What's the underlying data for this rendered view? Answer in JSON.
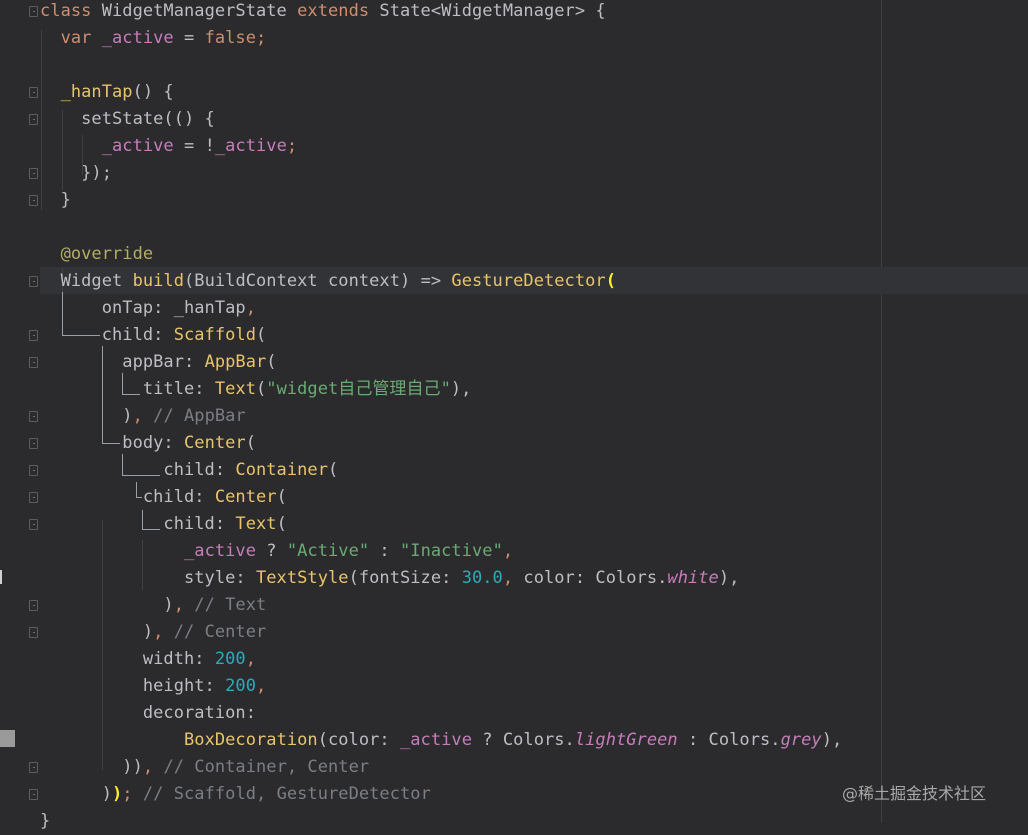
{
  "editor": {
    "lines": [
      [
        {
          "t": "class ",
          "c": "kw"
        },
        {
          "t": "WidgetManagerState ",
          "c": "plain"
        },
        {
          "t": "extends ",
          "c": "kw"
        },
        {
          "t": "State<WidgetManager> {",
          "c": "plain"
        }
      ],
      [
        {
          "t": "  ",
          "c": "plain"
        },
        {
          "t": "var ",
          "c": "kw"
        },
        {
          "t": "_active",
          "c": "prop"
        },
        {
          "t": " = ",
          "c": "plain"
        },
        {
          "t": "false",
          "c": "kw"
        },
        {
          "t": ";",
          "c": "kw"
        }
      ],
      [],
      [
        {
          "t": "  ",
          "c": "plain"
        },
        {
          "t": "_hanTap",
          "c": "cls"
        },
        {
          "t": "() {",
          "c": "plain"
        }
      ],
      [
        {
          "t": "    setState(() {",
          "c": "plain"
        }
      ],
      [
        {
          "t": "      ",
          "c": "plain"
        },
        {
          "t": "_active",
          "c": "prop"
        },
        {
          "t": " = !",
          "c": "plain"
        },
        {
          "t": "_active",
          "c": "prop"
        },
        {
          "t": ";",
          "c": "kw"
        }
      ],
      [
        {
          "t": "    });",
          "c": "plain"
        }
      ],
      [
        {
          "t": "  }",
          "c": "plain"
        }
      ],
      [],
      [
        {
          "t": "  ",
          "c": "plain"
        },
        {
          "t": "@override",
          "c": "ann"
        }
      ],
      [
        {
          "t": "  Widget ",
          "c": "plain"
        },
        {
          "t": "build",
          "c": "cls"
        },
        {
          "t": "(BuildContext context) => ",
          "c": "plain"
        },
        {
          "t": "GestureDetector",
          "c": "cls"
        },
        {
          "t": "(",
          "c": "brace-hl"
        }
      ],
      [
        {
          "t": "      onTap: _hanTap",
          "c": "plain"
        },
        {
          "t": ",",
          "c": "kw"
        }
      ],
      [
        {
          "t": "      child: ",
          "c": "plain"
        },
        {
          "t": "Scaffold",
          "c": "cls"
        },
        {
          "t": "(",
          "c": "plain"
        }
      ],
      [
        {
          "t": "        appBar: ",
          "c": "plain"
        },
        {
          "t": "AppBar",
          "c": "cls"
        },
        {
          "t": "(",
          "c": "plain"
        }
      ],
      [
        {
          "t": "          title: ",
          "c": "plain"
        },
        {
          "t": "Text",
          "c": "cls"
        },
        {
          "t": "(",
          "c": "plain"
        },
        {
          "t": "\"widget自己管理自己\"",
          "c": "str"
        },
        {
          "t": "),",
          "c": "plain"
        }
      ],
      [
        {
          "t": "        )",
          "c": "plain"
        },
        {
          "t": ", ",
          "c": "kw"
        },
        {
          "t": "// AppBar",
          "c": "cmt"
        }
      ],
      [
        {
          "t": "        body: ",
          "c": "plain"
        },
        {
          "t": "Center",
          "c": "cls"
        },
        {
          "t": "(",
          "c": "plain"
        }
      ],
      [
        {
          "t": "            child: ",
          "c": "plain"
        },
        {
          "t": "Container",
          "c": "cls"
        },
        {
          "t": "(",
          "c": "plain"
        }
      ],
      [
        {
          "t": "          child: ",
          "c": "plain"
        },
        {
          "t": "Center",
          "c": "cls"
        },
        {
          "t": "(",
          "c": "plain"
        }
      ],
      [
        {
          "t": "            child: ",
          "c": "plain"
        },
        {
          "t": "Text",
          "c": "cls"
        },
        {
          "t": "(",
          "c": "plain"
        }
      ],
      [
        {
          "t": "              ",
          "c": "plain"
        },
        {
          "t": "_active",
          "c": "prop"
        },
        {
          "t": " ? ",
          "c": "plain"
        },
        {
          "t": "\"Active\"",
          "c": "str"
        },
        {
          "t": " : ",
          "c": "plain"
        },
        {
          "t": "\"Inactive\"",
          "c": "str"
        },
        {
          "t": ",",
          "c": "kw"
        }
      ],
      [
        {
          "t": "              style: ",
          "c": "plain"
        },
        {
          "t": "TextStyle",
          "c": "cls"
        },
        {
          "t": "(fontSize: ",
          "c": "plain"
        },
        {
          "t": "30.0",
          "c": "num"
        },
        {
          "t": ", ",
          "c": "kw"
        },
        {
          "t": "color: Colors.",
          "c": "plain"
        },
        {
          "t": "white",
          "c": "static"
        },
        {
          "t": "),",
          "c": "plain"
        }
      ],
      [
        {
          "t": "            )",
          "c": "plain"
        },
        {
          "t": ", ",
          "c": "kw"
        },
        {
          "t": "// Text",
          "c": "cmt"
        }
      ],
      [
        {
          "t": "          )",
          "c": "plain"
        },
        {
          "t": ", ",
          "c": "kw"
        },
        {
          "t": "// Center",
          "c": "cmt"
        }
      ],
      [
        {
          "t": "          width: ",
          "c": "plain"
        },
        {
          "t": "200",
          "c": "num"
        },
        {
          "t": ",",
          "c": "kw"
        }
      ],
      [
        {
          "t": "          height: ",
          "c": "plain"
        },
        {
          "t": "200",
          "c": "num"
        },
        {
          "t": ",",
          "c": "kw"
        }
      ],
      [
        {
          "t": "          decoration:",
          "c": "plain"
        }
      ],
      [
        {
          "t": "              ",
          "c": "plain"
        },
        {
          "t": "BoxDecoration",
          "c": "cls"
        },
        {
          "t": "(color: ",
          "c": "plain"
        },
        {
          "t": "_active",
          "c": "prop"
        },
        {
          "t": " ? Colors.",
          "c": "plain"
        },
        {
          "t": "lightGreen",
          "c": "static"
        },
        {
          "t": " : Colors.",
          "c": "plain"
        },
        {
          "t": "grey",
          "c": "static"
        },
        {
          "t": "),",
          "c": "plain"
        }
      ],
      [
        {
          "t": "        ))",
          "c": "plain"
        },
        {
          "t": ", ",
          "c": "kw"
        },
        {
          "t": "// Container, Center",
          "c": "cmt"
        }
      ],
      [
        {
          "t": "      )",
          "c": "plain"
        },
        {
          "t": ")",
          "c": "brace-hl"
        },
        {
          "t": "; ",
          "c": "kw"
        },
        {
          "t": "// Scaffold, GestureDetector",
          "c": "cmt"
        }
      ],
      [
        {
          "t": "}",
          "c": "plain"
        }
      ]
    ]
  },
  "watermark": "@稀土掘金技术社区",
  "colors": {
    "background": "#2b2b2d",
    "keyword": "#cf8e6d",
    "class": "#e8c46a",
    "string": "#6aab73",
    "number": "#2aacb8",
    "property": "#c77dbb",
    "comment": "#7a7e85"
  }
}
